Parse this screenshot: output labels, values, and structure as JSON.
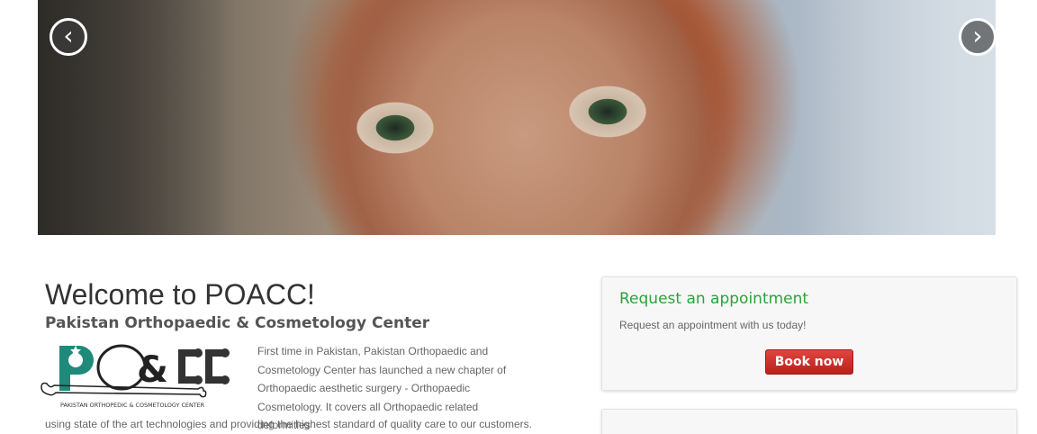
{
  "slider": {
    "prev_label": "‹",
    "next_label": "›",
    "prev_icon": "chevron-left-icon",
    "next_icon": "chevron-right-icon"
  },
  "welcome": {
    "title": "Welcome to POACC!",
    "subtitle": "Pakistan Orthopaedic & Cosmetology Center",
    "logo_text": "PAKISTAN ORTHOPEDIC & COSMETOLOGY CENTER",
    "intro_top": "First time in Pakistan, Pakistan Orthopaedic and Cosmetology Center has launched a new chapter of Orthopaedic aesthetic surgery - Orthopaedic Cosmetology. It covers all Orthopaedic related deformities",
    "intro_bottom": "using state of the art technologies and providing the highest standard of quality care to our customers."
  },
  "appointment": {
    "title": "Request an appointment",
    "text": "Request an appointment with us today!",
    "button_label": "Book now"
  },
  "colors": {
    "accent_green": "#2aa33c",
    "button_red": "#c9302c",
    "logo_teal": "#1f8a7a"
  }
}
